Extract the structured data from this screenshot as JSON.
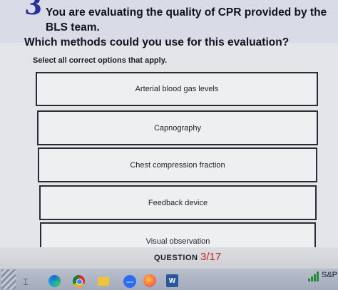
{
  "question": {
    "number": "3",
    "line1": "You are evaluating the quality of CPR provided by the BLS team.",
    "line2": "Which methods could you use for this evaluation?",
    "instruction": "Select all correct options that apply."
  },
  "options": [
    {
      "label": "Arterial blood gas levels"
    },
    {
      "label": "Capnography"
    },
    {
      "label": "Chest compression fraction"
    },
    {
      "label": "Feedback device"
    },
    {
      "label": "Visual observation"
    }
  ],
  "footer": {
    "question_label": "QUESTION",
    "current": "3",
    "total": "/17"
  },
  "taskbar": {
    "icons": [
      "cursor-icon",
      "edge-icon",
      "chrome-icon",
      "files-icon",
      "zoom-icon",
      "firefox-icon",
      "word-icon"
    ],
    "zoom_text": "zoom",
    "word_text": "W",
    "signal": "signal-icon",
    "tray_label": "S&P"
  },
  "colors": {
    "question_number": "#2a2f9a",
    "current_question": "#c2281e",
    "signal": "#238a3a"
  }
}
